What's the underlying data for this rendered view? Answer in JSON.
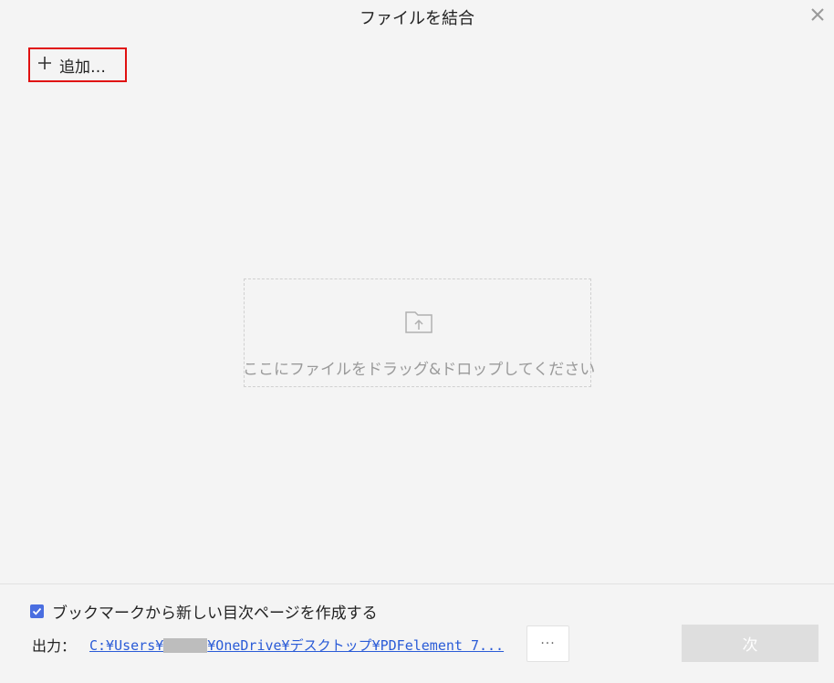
{
  "window": {
    "title": "ファイルを結合",
    "close_icon": "close-icon"
  },
  "toolbar": {
    "add_label": "追加…",
    "add_icon": "plus-icon"
  },
  "dropzone": {
    "icon": "folder-upload-icon",
    "text": "ここにファイルをドラッグ&ドロップしてください"
  },
  "options": {
    "bookmark_checked": true,
    "bookmark_label": "ブックマークから新しい目次ページを作成する"
  },
  "output": {
    "label": "出力：",
    "path_prefix": "C:¥Users¥",
    "path_suffix": "¥OneDrive¥デスクトップ¥PDFelement 7...",
    "browse_label": "···"
  },
  "footer": {
    "next_label": "次"
  },
  "colors": {
    "accent": "#4a6ee0",
    "highlight_border": "#e01010",
    "link": "#2a5bd7"
  }
}
